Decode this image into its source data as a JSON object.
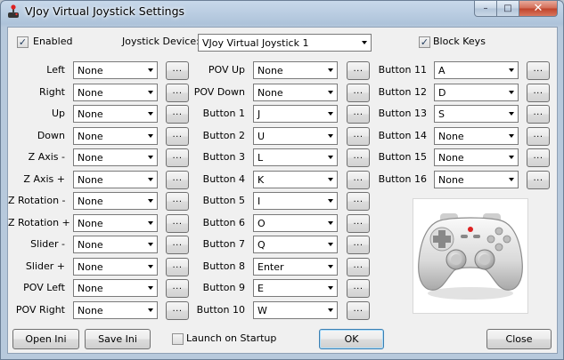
{
  "window": {
    "title": "VJoy Virtual Joystick Settings"
  },
  "caption": {
    "minimize": "–",
    "maximize": "□",
    "close": "✕"
  },
  "header": {
    "enabled_label": "Enabled",
    "device_label": "Joystick Device:",
    "device_value": "VJoy Virtual Joystick 1",
    "block_keys_label": "Block Keys"
  },
  "col1": [
    {
      "label": "Left",
      "value": "None"
    },
    {
      "label": "Right",
      "value": "None"
    },
    {
      "label": "Up",
      "value": "None"
    },
    {
      "label": "Down",
      "value": "None"
    },
    {
      "label": "Z Axis -",
      "value": "None"
    },
    {
      "label": "Z Axis +",
      "value": "None"
    },
    {
      "label": "Z Rotation -",
      "value": "None"
    },
    {
      "label": "Z Rotation +",
      "value": "None"
    },
    {
      "label": "Slider -",
      "value": "None"
    },
    {
      "label": "Slider +",
      "value": "None"
    },
    {
      "label": "POV Left",
      "value": "None"
    },
    {
      "label": "POV Right",
      "value": "None"
    }
  ],
  "col2": [
    {
      "label": "POV Up",
      "value": "None"
    },
    {
      "label": "POV Down",
      "value": "None"
    },
    {
      "label": "Button 1",
      "value": "J"
    },
    {
      "label": "Button 2",
      "value": "U"
    },
    {
      "label": "Button 3",
      "value": "L"
    },
    {
      "label": "Button 4",
      "value": "K"
    },
    {
      "label": "Button 5",
      "value": "I"
    },
    {
      "label": "Button 6",
      "value": "O"
    },
    {
      "label": "Button 7",
      "value": "Q"
    },
    {
      "label": "Button 8",
      "value": "Enter"
    },
    {
      "label": "Button 9",
      "value": "E"
    },
    {
      "label": "Button 10",
      "value": "W"
    }
  ],
  "col3": [
    {
      "label": "Button 11",
      "value": "A"
    },
    {
      "label": "Button 12",
      "value": "D"
    },
    {
      "label": "Button 13",
      "value": "S"
    },
    {
      "label": "Button 14",
      "value": "None"
    },
    {
      "label": "Button 15",
      "value": "None"
    },
    {
      "label": "Button 16",
      "value": "None"
    }
  ],
  "browse_label": "...",
  "footer": {
    "open_ini": "Open Ini",
    "save_ini": "Save Ini",
    "launch_label": "Launch on Startup",
    "ok": "OK",
    "close": "Close"
  },
  "icons": {
    "app": "joystick-icon",
    "gamepad": "gamepad-illustration"
  }
}
